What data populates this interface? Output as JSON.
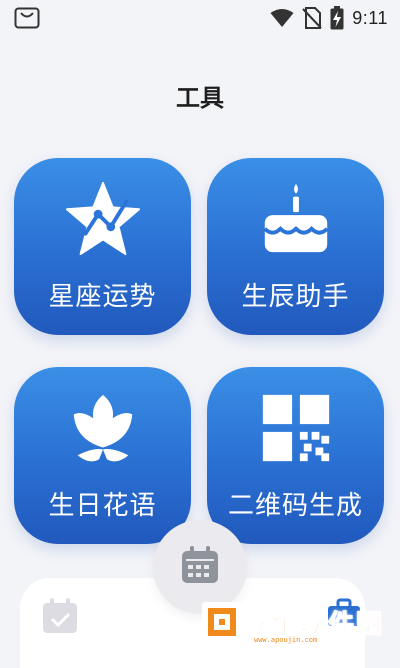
{
  "status_bar": {
    "time": "9:11",
    "icons": [
      "store-bag-icon",
      "wifi-icon",
      "no-sim-icon",
      "battery-charging-icon"
    ]
  },
  "page": {
    "title": "工具"
  },
  "tools": [
    {
      "label": "星座运势",
      "icon": "star-chart-icon"
    },
    {
      "label": "生辰助手",
      "icon": "birthday-cake-icon"
    },
    {
      "label": "生日花语",
      "icon": "flower-icon"
    },
    {
      "label": "二维码生成",
      "icon": "qr-code-icon"
    }
  ],
  "bottom_nav": {
    "center_icon": "calendar-icon",
    "left_icon": "calendar-check-icon",
    "right_icon": "toolbox-icon"
  },
  "watermark": {
    "text": "欧金软件园",
    "sub": "www.apoujin.com"
  },
  "colors": {
    "tile_top": "#3a8fe6",
    "tile_bottom": "#2159bd",
    "background": "#f3f4f8",
    "watermark": "#f08a1a"
  }
}
